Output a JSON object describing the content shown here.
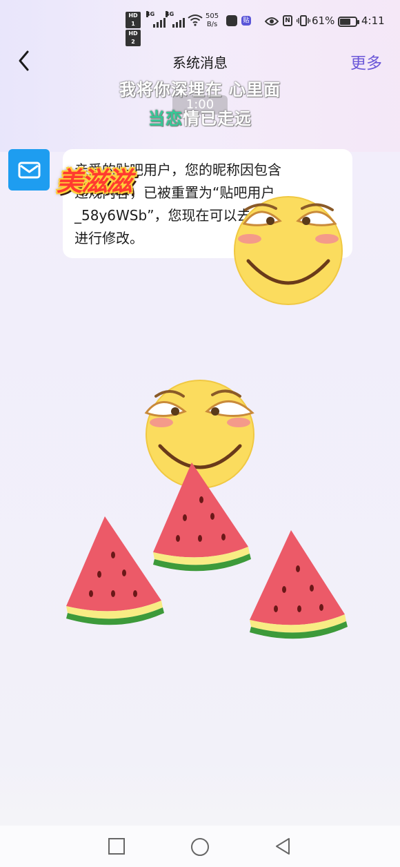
{
  "status_bar": {
    "hd1": "HD 1",
    "hd2": "HD 2",
    "net1": "4G",
    "net2": "4G",
    "speed_value": "505",
    "speed_unit": "B/s",
    "app_badge": "贴",
    "nfc": "N",
    "battery_percent": "61%",
    "battery_level": 0.61,
    "time": "4:11"
  },
  "header": {
    "title": "系统消息",
    "more_label": "更多"
  },
  "lyrics": {
    "line1": "我将你深埋在 心里面",
    "time": "1:00",
    "line2_highlight": "当恋",
    "line2_rest": "情已走远"
  },
  "message": {
    "line1": "亲爱的贴吧用户，您的昵称因包含",
    "line2": "违规内容，已被重置为“贴吧用户",
    "line3": "_58y6WSb”，您现在可以去个人页",
    "line4": "进行修改。"
  },
  "sticker": {
    "text": "美滋滋"
  },
  "colors": {
    "accent": "#6a56d8",
    "mail_blue": "#1e9df0",
    "lyric_highlight": "#35c996"
  }
}
